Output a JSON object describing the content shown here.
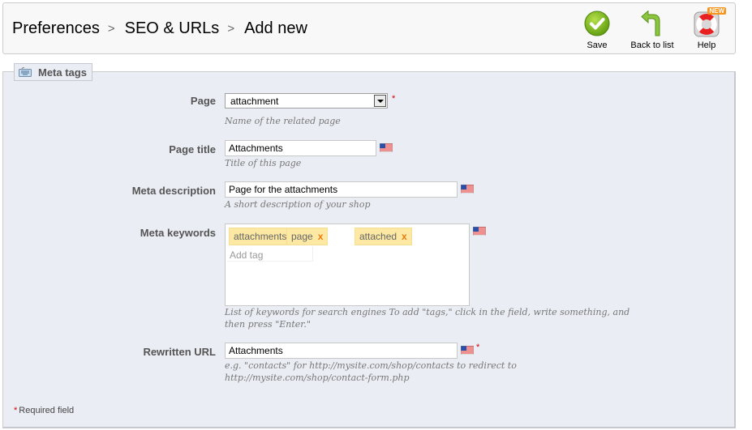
{
  "breadcrumb": [
    "Preferences",
    "SEO & URLs",
    "Add new"
  ],
  "breadcrumb_separator": ">",
  "toolbar": {
    "save_label": "Save",
    "back_label": "Back to list",
    "help_label": "Help",
    "help_badge": "NEW"
  },
  "fieldset": {
    "legend": "Meta tags",
    "fields": {
      "page": {
        "label": "Page",
        "value": "attachment",
        "hint": "Name of the related page",
        "required": "*"
      },
      "page_title": {
        "label": "Page title",
        "value": "Attachments",
        "hint": "Title of this page"
      },
      "meta_description": {
        "label": "Meta description",
        "value": "Page for the attachments",
        "hint": "A short description of your shop"
      },
      "meta_keywords": {
        "label": "Meta keywords",
        "tags": [
          "attachments",
          "page",
          "attached"
        ],
        "tag_remove": "x",
        "placeholder": "Add tag",
        "hint_line1": "List of keywords for search engines To add \"tags,\" click in the field, write something, and",
        "hint_line2": "then press \"Enter.\""
      },
      "rewritten_url": {
        "label": "Rewritten URL",
        "value": "Attachments",
        "required": "*",
        "hint_line1": "e.g. \"contacts\" for http://mysite.com/shop/contacts to redirect to",
        "hint_line2": "http://mysite.com/shop/contact-form.php"
      }
    },
    "required_note_star": "*",
    "required_note": "Required field"
  },
  "colors": {
    "panel_bg": "#ebedf4",
    "tag_bg": "#fde8a4",
    "tag_remove": "#e87b11",
    "required": "#cc0000",
    "save_green": "#7fb81c"
  }
}
